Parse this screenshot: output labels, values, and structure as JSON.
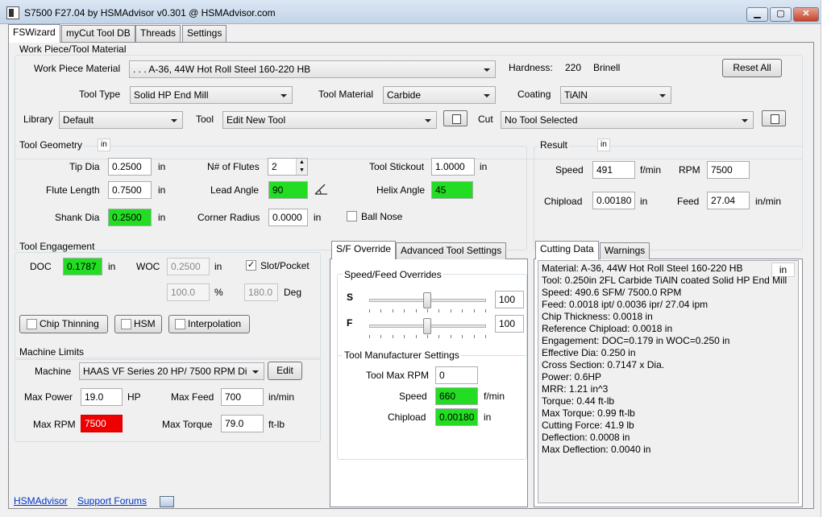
{
  "window": {
    "title": "S7500 F27.04 by HSMAdvisor v0.301 @ HSMAdvisor.com",
    "min": "▁",
    "max": "▢",
    "close": "✕"
  },
  "tabs": [
    "FSWizard",
    "myCut Tool DB",
    "Threads",
    "Settings"
  ],
  "workpiece": {
    "group_title": "Work Piece/Tool Material",
    "material_label": "Work Piece Material",
    "material_value": ". . . A-36, 44W Hot Roll Steel 160-220 HB",
    "hardness_label": "Hardness:",
    "hardness_value": "220",
    "hardness_unit": "Brinell",
    "reset_label": "Reset All",
    "tool_type_label": "Tool Type",
    "tool_type_value": "Solid HP End Mill",
    "tool_material_label": "Tool Material",
    "tool_material_value": "Carbide",
    "coating_label": "Coating",
    "coating_value": "TiAlN",
    "library_label": "Library",
    "library_value": "Default",
    "tool_label": "Tool",
    "tool_value": "Edit New Tool",
    "cut_label": "Cut",
    "cut_value": "No Tool Selected"
  },
  "geometry": {
    "title": "Tool Geometry",
    "unit": "in",
    "tip_dia_label": "Tip Dia",
    "tip_dia": "0.2500",
    "tip_dia_unit": "in",
    "flutes_label": "N# of Flutes",
    "flutes": "2",
    "stickout_label": "Tool Stickout",
    "stickout": "1.0000",
    "stickout_unit": "in",
    "flute_len_label": "Flute Length",
    "flute_len": "0.7500",
    "flute_len_unit": "in",
    "lead_label": "Lead Angle",
    "lead": "90",
    "helix_label": "Helix Angle",
    "helix": "45",
    "shank_label": "Shank Dia",
    "shank": "0.2500",
    "shank_unit": "in",
    "corner_label": "Corner Radius",
    "corner": "0.0000",
    "corner_unit": "in",
    "ballnose_label": "Ball Nose"
  },
  "result": {
    "title": "Result",
    "unit": "in",
    "speed_label": "Speed",
    "speed": "491",
    "speed_unit": "f/min",
    "rpm_label": "RPM",
    "rpm": "7500",
    "chipload_label": "Chipload",
    "chipload": "0.00180",
    "chipload_unit": "in",
    "feed_label": "Feed",
    "feed": "27.04",
    "feed_unit": "in/min"
  },
  "engagement": {
    "title": "Tool Engagement",
    "doc_label": "DOC",
    "doc": "0.1787",
    "doc_unit": "in",
    "woc_label": "WOC",
    "woc": "0.2500",
    "woc_unit": "in",
    "slot_label": "Slot/Pocket",
    "slot_checked": "✓",
    "woc_pct": "100.0",
    "pct_unit": "%",
    "deg": "180.0",
    "deg_unit": "Deg",
    "chip_thinning": "Chip Thinning",
    "hsm": "HSM",
    "interpolation": "Interpolation"
  },
  "machine": {
    "title": "Machine Limits",
    "machine_label": "Machine",
    "machine_value": "HAAS VF Series 20 HP/ 7500 RPM Di",
    "edit_label": "Edit",
    "power_label": "Max Power",
    "power": "19.0",
    "power_unit": "HP",
    "feed_label": "Max Feed",
    "feed": "700",
    "feed_unit": "in/min",
    "rpm_label": "Max RPM",
    "rpm": "7500",
    "torque_label": "Max Torque",
    "torque": "79.0",
    "torque_unit": "ft-lb"
  },
  "override": {
    "tabs": [
      "S/F Override",
      "Advanced Tool Settings"
    ],
    "group_title": "Speed/Feed Overrides",
    "s_label": "S",
    "s_value": "100",
    "f_label": "F",
    "f_value": "100",
    "s_level_pct": 100,
    "f_level_pct": 100,
    "mfr_title": "Tool Manufacturer Settings",
    "max_rpm_label": "Tool Max RPM",
    "max_rpm": "0",
    "speed_label": "Speed",
    "speed": "660",
    "speed_unit": "f/min",
    "chipload_label": "Chipload",
    "chipload": "0.00180",
    "chipload_unit": "in"
  },
  "cutting": {
    "tabs": [
      "Cutting Data",
      "Warnings"
    ],
    "unit": "in",
    "lines": [
      "Material: A-36, 44W Hot Roll Steel 160-220 HB",
      "Tool: 0.250in 2FL Carbide TiAlN coated Solid HP End Mill",
      "Speed: 490.6 SFM/ 7500.0 RPM",
      "Feed: 0.0018 ipt/ 0.0036 ipr/ 27.04 ipm",
      "Chip Thickness: 0.0018 in",
      "Reference Chipload: 0.0018 in",
      "Engagement:  DOC=0.179 in   WOC=0.250 in",
      "Effective Dia: 0.250 in",
      "Cross Section: 0.7147 x Dia.",
      "Power: 0.6HP",
      "MRR: 1.21 in^3",
      "Torque: 0.44 ft-lb",
      "Max Torque: 0.99 ft-lb",
      "Cutting Force: 41.9 lb",
      "Deflection: 0.0008 in",
      "Max Deflection: 0.0040 in"
    ]
  },
  "footer": {
    "link1": "HSMAdvisor",
    "link2": "Support Forums"
  }
}
